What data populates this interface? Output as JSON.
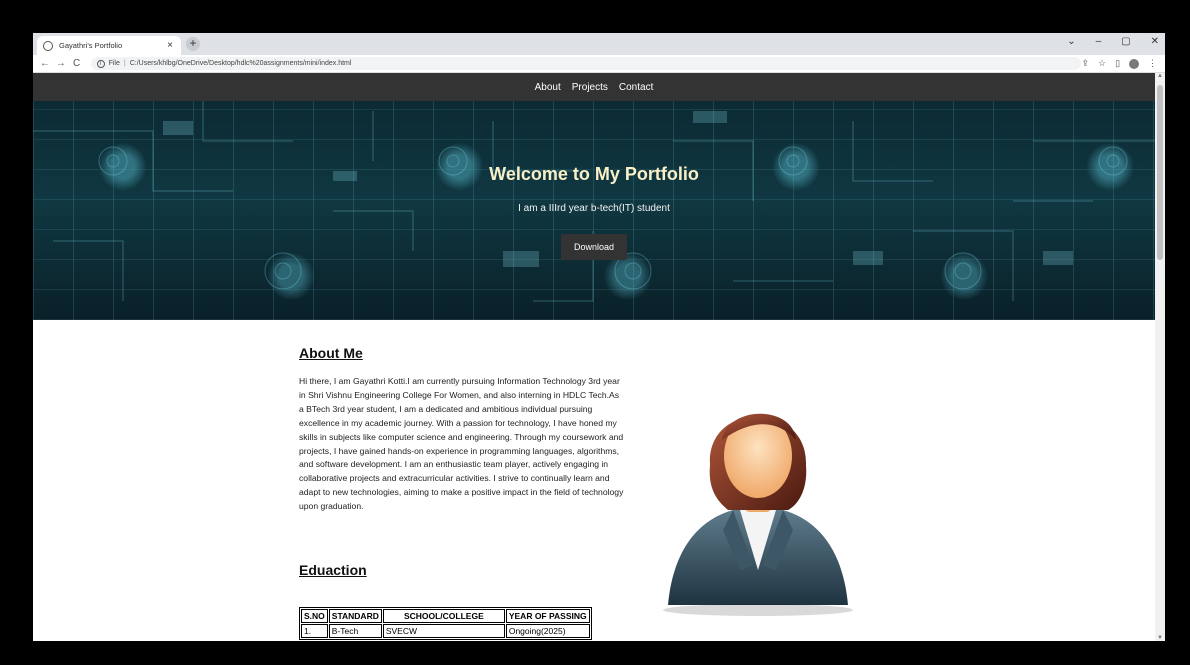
{
  "browser": {
    "tab_title": "Gayathri's Portfolio",
    "tab_close": "×",
    "new_tab": "+",
    "window_controls": [
      "⌄",
      "–",
      "▢",
      "✕"
    ],
    "back": "←",
    "forward": "→",
    "reload": "C",
    "info_glyph": "i",
    "url_prefix": "File",
    "url": "C:/Users/khlbg/OneDrive/Desktop/hdlc%20assignments/mini/index.html",
    "share": "⇪",
    "bookmark": "☆",
    "sidebar": "▯",
    "menu": "⋮"
  },
  "nav": {
    "links": [
      "About",
      "Projects",
      "Contact"
    ]
  },
  "hero": {
    "title": "Welcome to My Portfolio",
    "subtitle": "I am a IIIrd year b-tech(IT) student",
    "button": "Download"
  },
  "about": {
    "heading": "About Me",
    "text": "Hi there, I am Gayathri Kotti.I am currently pursuing Information Technology 3rd year in Shri Vishnu Engineering College For Women, and also interning in HDLC Tech.As a BTech 3rd year student, I am a dedicated and ambitious individual pursuing excellence in my academic journey. With a passion for technology, I have honed my skills in subjects like computer science and engineering. Through my coursework and projects, I have gained hands-on experience in programming languages, algorithms, and software development. I am an enthusiastic team player, actively engaging in collaborative projects and extracurricular activities. I strive to continually learn and adapt to new technologies, aiming to make a positive impact in the field of technology upon graduation."
  },
  "education": {
    "heading": "Eduaction",
    "columns": [
      "S.NO",
      "STANDARD",
      "SCHOOL/COLLEGE",
      "YEAR OF PASSING"
    ],
    "rows": [
      [
        "1.",
        "B-Tech",
        "SVECW",
        "Ongoing(2025)"
      ]
    ]
  },
  "scrollbar": {
    "up": "▲",
    "down": "▼"
  }
}
